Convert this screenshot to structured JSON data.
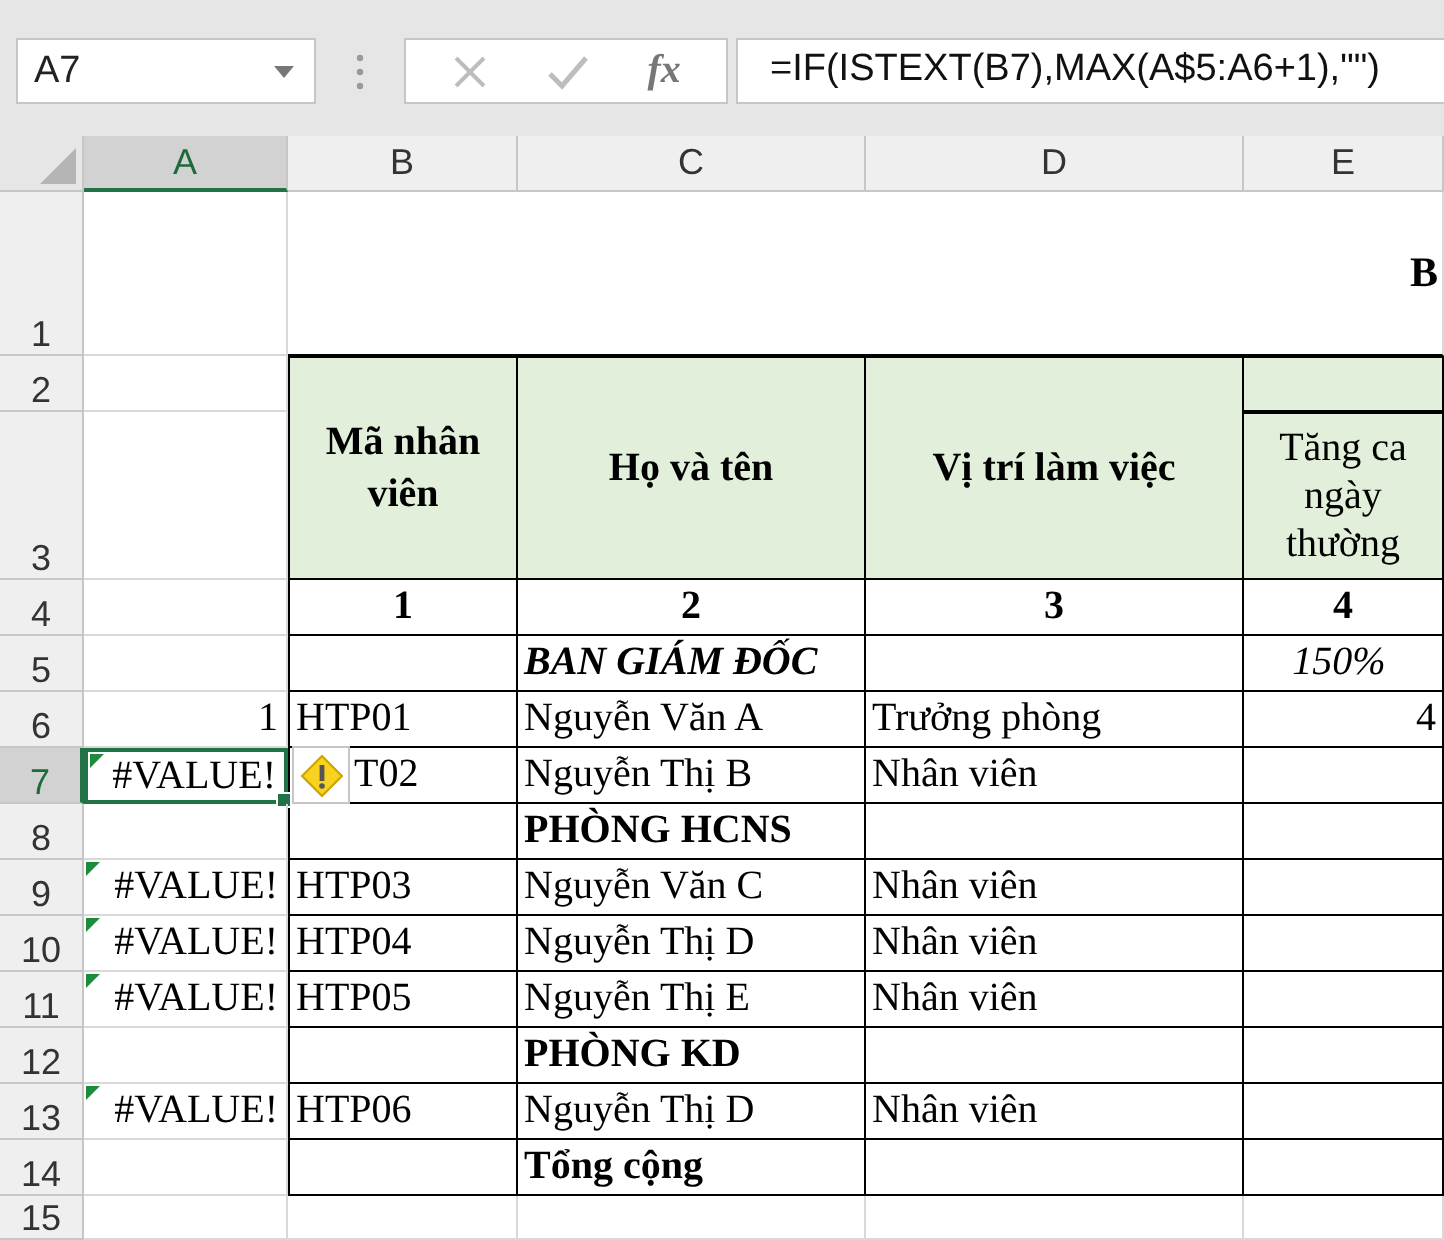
{
  "name_box": "A7",
  "function_button": "fx",
  "formula": "=IF(ISTEXT(B7),MAX(A$5:A6+1),\"\")",
  "columns": [
    {
      "label": "A",
      "selected": true
    },
    {
      "label": "B",
      "selected": false
    },
    {
      "label": "C",
      "selected": false
    },
    {
      "label": "D",
      "selected": false
    },
    {
      "label": "E",
      "selected": false
    }
  ],
  "row_headers": [
    {
      "label": "1",
      "selected": false
    },
    {
      "label": "2",
      "selected": false
    },
    {
      "label": "3",
      "selected": false
    },
    {
      "label": "4",
      "selected": false
    },
    {
      "label": "5",
      "selected": false
    },
    {
      "label": "6",
      "selected": false
    },
    {
      "label": "7",
      "selected": true
    },
    {
      "label": "8",
      "selected": false
    },
    {
      "label": "9",
      "selected": false
    },
    {
      "label": "10",
      "selected": false
    },
    {
      "label": "11",
      "selected": false
    },
    {
      "label": "12",
      "selected": false
    },
    {
      "label": "13",
      "selected": false
    },
    {
      "label": "14",
      "selected": false
    },
    {
      "label": "15",
      "selected": false
    }
  ],
  "title": "B",
  "table_header": {
    "columns": [
      "Mã nhân viên",
      "Họ và tên",
      "Vị trí làm việc"
    ],
    "overtime": "Tăng ca ngày thường",
    "numbers": [
      "1",
      "2",
      "3",
      "4"
    ]
  },
  "rows": [
    {
      "kind": "section",
      "italic": true,
      "name": "BAN GIÁM ĐỐC",
      "rate": "150%",
      "selected": false
    },
    {
      "kind": "employee",
      "index": "1",
      "code": "HTP01",
      "name": "Nguyễn Văn A",
      "position": "Trưởng phòng",
      "overtime": "4",
      "selected": false
    },
    {
      "kind": "employee",
      "index": "#VALUE!",
      "code": "T02",
      "name": "Nguyễn Thị B",
      "position": "Nhân viên",
      "selected": true,
      "error": true,
      "warning": true
    },
    {
      "kind": "section",
      "italic": false,
      "name": "PHÒNG HCNS",
      "selected": false
    },
    {
      "kind": "employee",
      "index": "#VALUE!",
      "code": "HTP03",
      "name": "Nguyễn Văn C",
      "position": "Nhân viên",
      "selected": false,
      "error": true
    },
    {
      "kind": "employee",
      "index": "#VALUE!",
      "code": "HTP04",
      "name": "Nguyễn Thị D",
      "position": "Nhân viên",
      "selected": false,
      "error": true
    },
    {
      "kind": "employee",
      "index": "#VALUE!",
      "code": "HTP05",
      "name": "Nguyễn Thị E",
      "position": "Nhân viên",
      "selected": false,
      "error": true
    },
    {
      "kind": "section",
      "italic": false,
      "name": "PHÒNG KD",
      "selected": false
    },
    {
      "kind": "employee",
      "index": "#VALUE!",
      "code": "HTP06",
      "name": "Nguyễn Thị D",
      "position": "Nhân viên",
      "selected": false,
      "error": true
    },
    {
      "kind": "total",
      "name": "Tổng cộng",
      "selected": false
    }
  ]
}
